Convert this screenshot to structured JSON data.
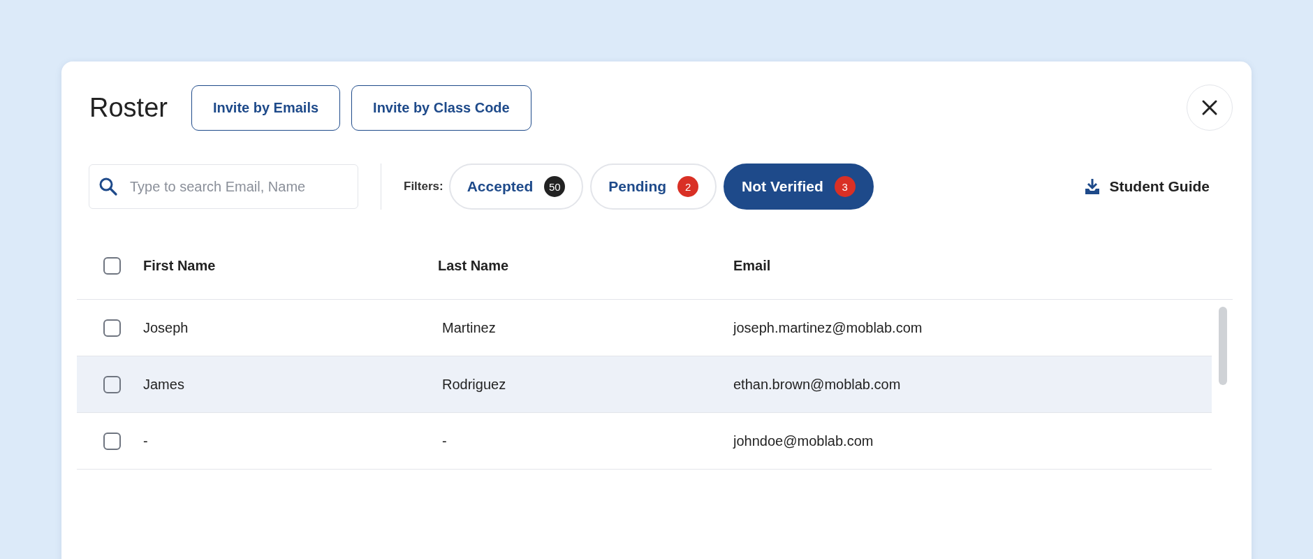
{
  "dialog": {
    "title": "Roster",
    "actions": [
      {
        "label": "Invite by Emails"
      },
      {
        "label": "Invite by Class Code"
      }
    ]
  },
  "search": {
    "placeholder": "Type to search Email, Name"
  },
  "filters": {
    "label": "Filters:",
    "items": [
      {
        "label": "Accepted",
        "count": "50",
        "color": "#222222",
        "selected": false
      },
      {
        "label": "Pending",
        "count": "2",
        "color": "#d93025",
        "selected": false
      },
      {
        "label": "Not Verified",
        "count": "3",
        "color": "#d93025",
        "selected": true
      }
    ]
  },
  "guide_link": {
    "label": "Student Guide"
  },
  "table": {
    "select_all_checked": false,
    "columns": [
      "First Name",
      "Last Name",
      "Email"
    ],
    "rows": [
      {
        "cells": [
          "Joseph",
          "Martinez",
          "joseph.martinez@moblab.com"
        ],
        "checked": false,
        "highlighted": false
      },
      {
        "cells": [
          "James",
          "Rodriguez",
          "ethan.brown@moblab.com"
        ],
        "checked": false,
        "highlighted": true
      },
      {
        "cells": [
          "-",
          "-",
          "johndoe@moblab.com"
        ],
        "checked": false,
        "highlighted": false
      }
    ]
  }
}
